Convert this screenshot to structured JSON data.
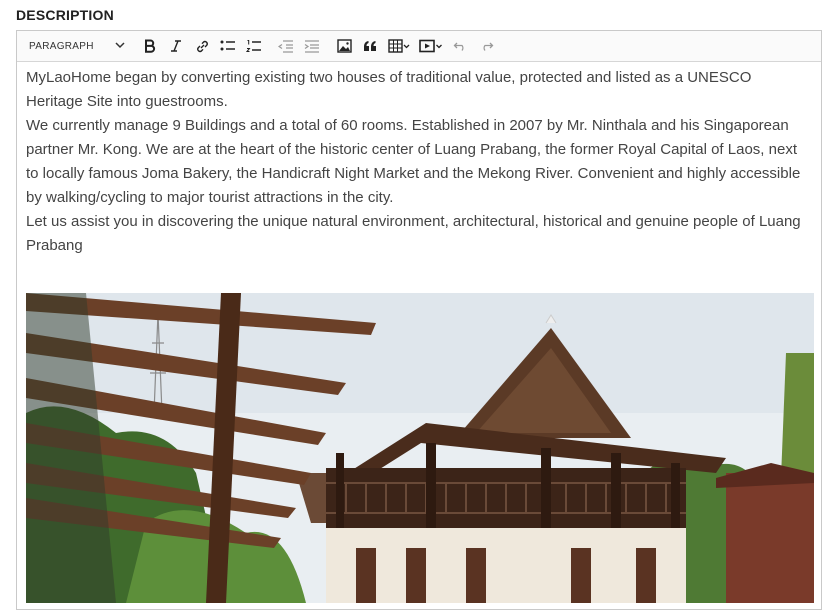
{
  "field": {
    "label": "DESCRIPTION"
  },
  "toolbar": {
    "paragraph_select": "PARAGRAPH",
    "buttons": [
      "bold-icon",
      "italic-icon",
      "link-icon",
      "bulleted-list-icon",
      "numbered-list-icon",
      "outdent-icon",
      "indent-icon",
      "image-icon",
      "quote-icon",
      "table-icon",
      "media-icon",
      "undo-icon",
      "redo-icon"
    ]
  },
  "content": {
    "paragraphs": [
      "MyLaoHome began by converting existing two houses of traditional value, protected and listed as a UNESCO Heritage Site into guestrooms.",
      "We currently manage 9 Buildings and a total of 60 rooms. Established in 2007 by Mr. Ninthala and his Singaporean partner Mr. Kong. We are at the heart of the historic center of Luang Prabang, the former Royal Capital of Laos, next to locally famous Joma Bakery, the Handicraft Night Market and the Mekong River. Convenient and highly accessible by walking/cycling to major tourist attractions in the city.",
      "Let us assist you in discovering the unique natural environment, architectural, historical and genuine people of Luang Prabang"
    ]
  },
  "colors": {
    "text": "#444444",
    "label": "#222222",
    "border": "#c9c9c9",
    "toolbar_bg": "#fafafa"
  }
}
